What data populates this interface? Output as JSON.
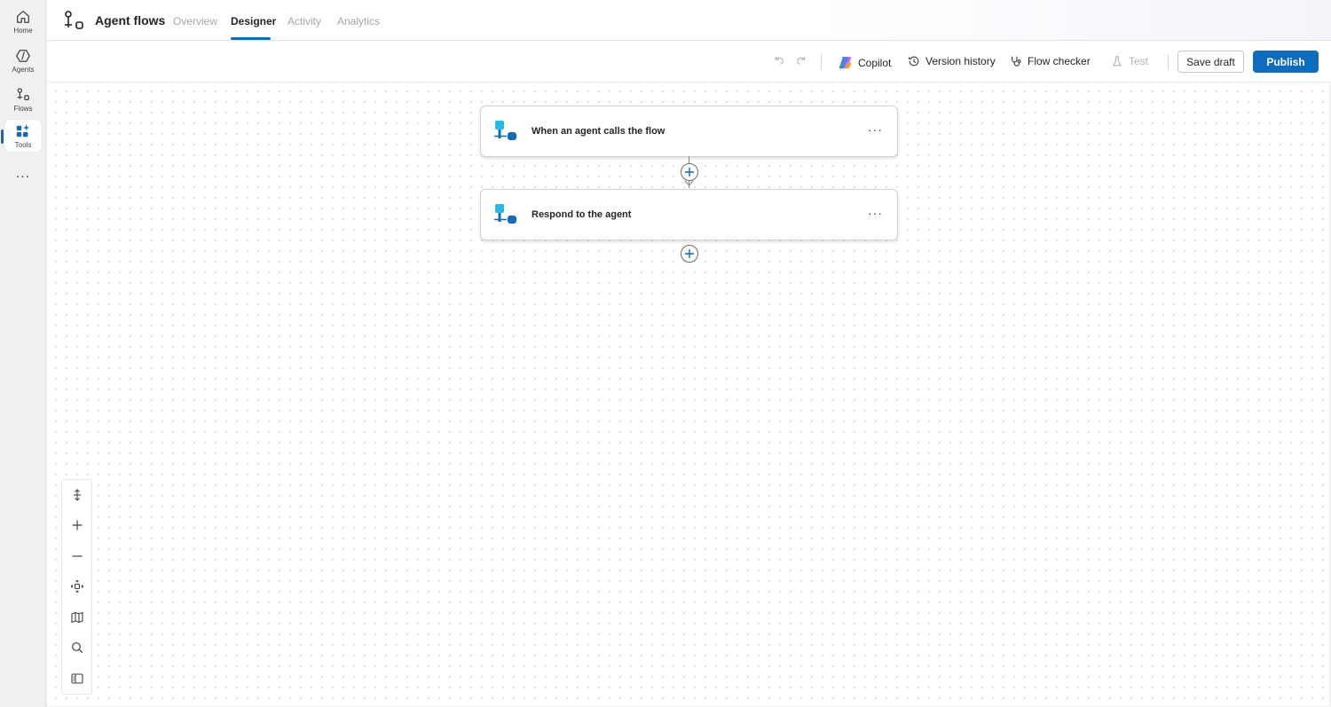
{
  "rail": {
    "items": [
      {
        "label": "Home",
        "icon": "home-icon"
      },
      {
        "label": "Agents",
        "icon": "agents-icon"
      },
      {
        "label": "Flows",
        "icon": "flows-icon"
      },
      {
        "label": "Tools",
        "icon": "tools-icon"
      }
    ],
    "more": "..."
  },
  "header": {
    "title": "Agent flows",
    "tabs": [
      {
        "label": "Overview"
      },
      {
        "label": "Designer"
      },
      {
        "label": "Activity"
      },
      {
        "label": "Analytics"
      }
    ],
    "active_tab": "Designer"
  },
  "commands": {
    "copilot": "Copilot",
    "version_history": "Version history",
    "flow_checker": "Flow checker",
    "test": "Test",
    "save_draft": "Save draft",
    "publish": "Publish"
  },
  "flow": {
    "nodes": [
      {
        "title": "When an agent calls the flow",
        "more": "···"
      },
      {
        "title": "Respond to the agent",
        "more": "···"
      }
    ]
  },
  "colors": {
    "accent": "#0f6cbd",
    "node_icon_light": "#29b6e8",
    "node_icon_dark": "#0f6cbd"
  },
  "zoom_tools": [
    "fit-height-icon",
    "zoom-in-icon",
    "zoom-out-icon",
    "fit-view-icon",
    "minimap-icon",
    "search-icon",
    "panel-icon"
  ]
}
